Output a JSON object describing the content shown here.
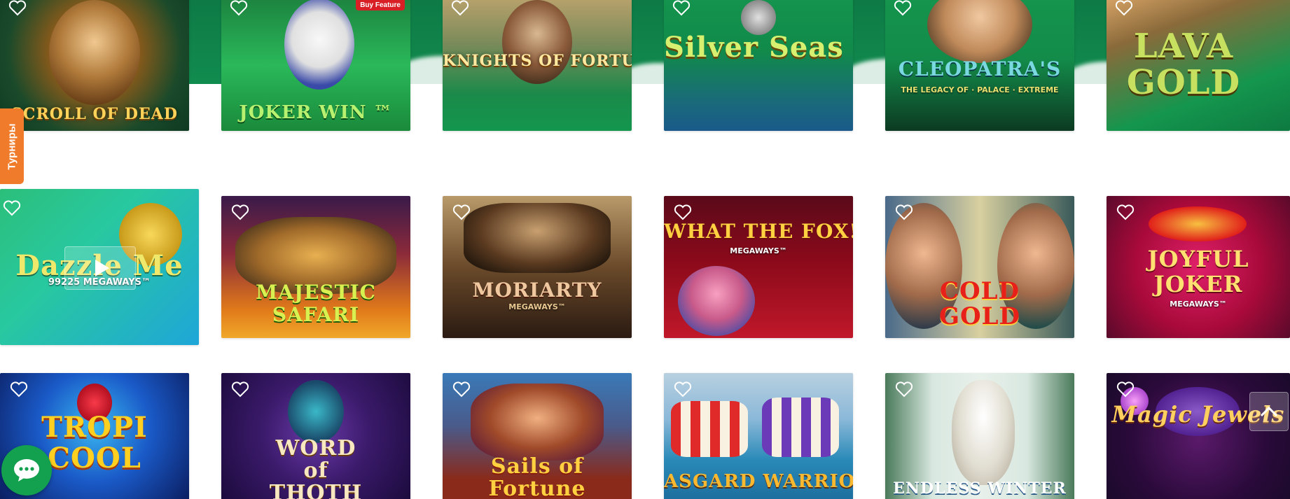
{
  "tournaments_tab": {
    "label": "Турниры"
  },
  "rows": [
    {
      "games": [
        {
          "name": "Scroll of Dead",
          "title": "SCROLL OF DEAD",
          "icon": "heart-outline-icon",
          "palette": [
            "#1a6b3a",
            "#c79a2e"
          ]
        },
        {
          "name": "Joker Win",
          "title": "JOKER WIN ™",
          "badge": "Buy Feature",
          "icon": "heart-outline-icon",
          "palette": [
            "#1aa34a",
            "#3a8c3f"
          ]
        },
        {
          "name": "Knights of Fortune",
          "title": "KNIGHTS OF FORTUNE",
          "icon": "heart-outline-icon",
          "palette": [
            "#1c7b3e",
            "#b59545"
          ]
        },
        {
          "name": "Silver Seas",
          "title": "Silver Seas ™",
          "icon": "heart-outline-icon",
          "palette": [
            "#0f8a4a",
            "#1c6a8a"
          ]
        },
        {
          "name": "The Legacy of Cleopatra's Palace Extreme",
          "title": "CLEOPATRA'S",
          "subtitle": "THE LEGACY OF · PALACE · EXTREME",
          "icon": "heart-outline-icon",
          "palette": [
            "#12964a",
            "#0d2d1f"
          ]
        },
        {
          "name": "Lava Gold",
          "title": "LAVA GOLD",
          "icon": "heart-outline-icon",
          "palette": [
            "#139a4c",
            "#5a3a1a"
          ]
        }
      ]
    },
    {
      "games": [
        {
          "name": "Dazzle Me 99225 Megaways",
          "title": "Dazzle Me",
          "subtitle": "99225 MEGAWAYS™",
          "icon": "heart-outline-icon",
          "palette": [
            "#2bbf7a",
            "#1ea6d8"
          ],
          "hovered": true
        },
        {
          "name": "Majestic Safari",
          "title": "MAJESTIC SAFARI",
          "icon": "heart-outline-icon",
          "palette": [
            "#3a1a4a",
            "#e07a1a"
          ]
        },
        {
          "name": "Moriarty Megaways",
          "title": "MORIARTY",
          "subtitle": "MEGAWAYS™",
          "icon": "heart-outline-icon",
          "palette": [
            "#6a4a2a",
            "#2a1a12"
          ]
        },
        {
          "name": "What The Fox Megaways",
          "title": "WHAT THE FOX!",
          "subtitle": "MEGAWAYS™",
          "icon": "heart-outline-icon",
          "palette": [
            "#6a0a1a",
            "#c0182a"
          ]
        },
        {
          "name": "Cold Gold",
          "title": "COLD GOLD",
          "icon": "heart-outline-icon",
          "palette": [
            "#4a6a8a",
            "#d8d0a0"
          ]
        },
        {
          "name": "Joyful Joker Megaways",
          "title": "JOYFUL JOKER",
          "subtitle": "MEGAWAYS™",
          "icon": "heart-outline-icon",
          "palette": [
            "#8a0a3a",
            "#c8104a"
          ]
        }
      ]
    },
    {
      "games": [
        {
          "name": "Tropicool",
          "title": "TROPI COOL",
          "icon": "heart-outline-icon",
          "palette": [
            "#0a2a7a",
            "#1a8ad8"
          ]
        },
        {
          "name": "Word of Thoth",
          "title": "WORD of THOTH",
          "icon": "heart-outline-icon",
          "palette": [
            "#1a0a3a",
            "#4a2a7a"
          ]
        },
        {
          "name": "Sails of Fortune",
          "title": "Sails of Fortune",
          "icon": "heart-outline-icon",
          "palette": [
            "#3a7ab8",
            "#c8501a"
          ]
        },
        {
          "name": "Asgard Warriors",
          "title": "ASGARD WARRIORS",
          "icon": "heart-outline-icon",
          "palette": [
            "#8ab8d8",
            "#1a7ab8"
          ]
        },
        {
          "name": "Endless Winter",
          "title": "ENDLESS WINTER",
          "icon": "heart-outline-icon",
          "palette": [
            "#d8e8e0",
            "#4a7a5a"
          ]
        },
        {
          "name": "Magic Jewels",
          "title": "Magic Jewels",
          "icon": "heart-outline-icon",
          "palette": [
            "#2a0a3a",
            "#6a1a6a"
          ]
        }
      ]
    }
  ],
  "widgets": {
    "chat_icon": "chat-bubble-icon",
    "scroll_top_icon": "chevron-up-icon",
    "play_icon": "play-icon"
  }
}
